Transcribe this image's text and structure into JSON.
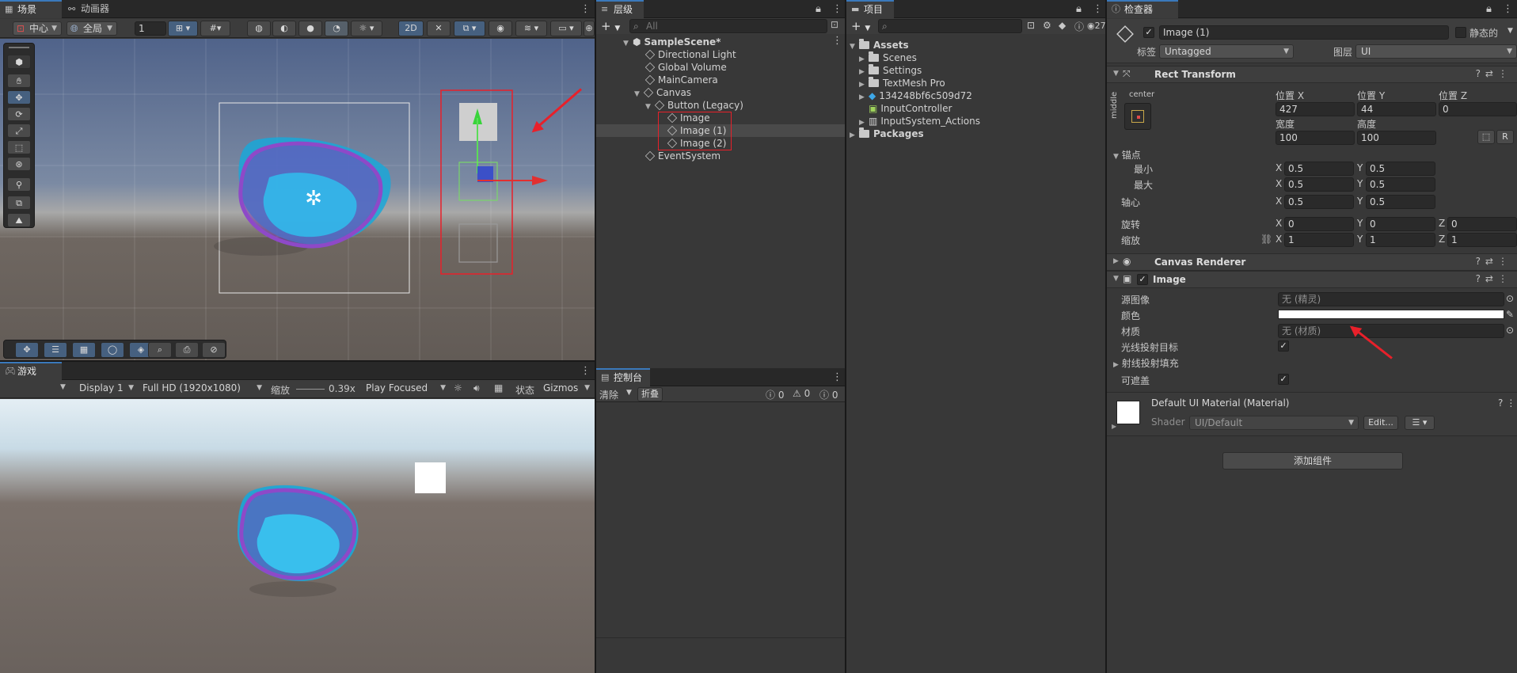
{
  "scene_tabs": {
    "scene": "场景",
    "animator": "动画器"
  },
  "scene_toolbar": {
    "pivot": "中心",
    "space": "全局",
    "grid_value": "1",
    "mode_2d": "2D"
  },
  "game_tab": "游戏",
  "game_toolbar": {
    "display": "Display 1",
    "resolution": "Full HD (1920x1080)",
    "scale_label": "缩放",
    "scale_value": "0.39x",
    "play_mode": "Play Focused",
    "stats": "状态",
    "gizmos": "Gizmos"
  },
  "hierarchy": {
    "tab": "层级",
    "search_placeholder": "All",
    "items": [
      {
        "label": "SampleScene*"
      },
      {
        "label": "Directional Light"
      },
      {
        "label": "Global Volume"
      },
      {
        "label": "MainCamera"
      },
      {
        "label": "Canvas"
      },
      {
        "label": "Button (Legacy)"
      },
      {
        "label": "Image"
      },
      {
        "label": "Image (1)"
      },
      {
        "label": "Image (2)"
      },
      {
        "label": "EventSystem"
      }
    ]
  },
  "console": {
    "tab": "控制台",
    "clear": "清除",
    "collapse": "折叠",
    "count_log": "0",
    "count_warn": "0",
    "count_error": "0"
  },
  "project": {
    "tab": "项目",
    "count": "27",
    "items": [
      {
        "label": "Assets"
      },
      {
        "label": "Scenes"
      },
      {
        "label": "Settings"
      },
      {
        "label": "TextMesh Pro"
      },
      {
        "label": "134248bf6c509d72"
      },
      {
        "label": "InputController"
      },
      {
        "label": "InputSystem_Actions"
      },
      {
        "label": "Packages"
      }
    ]
  },
  "inspector": {
    "tab": "检查器",
    "object_name": "Image (1)",
    "static_label": "静态的",
    "tag_label": "标签",
    "tag_value": "Untagged",
    "layer_label": "图层",
    "layer_value": "UI",
    "rect_transform": {
      "title": "Rect Transform",
      "anchor_h": "center",
      "anchor_v": "middle",
      "pos_x_label": "位置 X",
      "pos_y_label": "位置 Y",
      "pos_z_label": "位置 Z",
      "pos_x": "427",
      "pos_y": "44",
      "pos_z": "0",
      "width_label": "宽度",
      "height_label": "高度",
      "width": "100",
      "height": "100",
      "r_button": "R",
      "anchors_label": "锚点",
      "min_label": "最小",
      "max_label": "最大",
      "min_x": "0.5",
      "min_y": "0.5",
      "max_x": "0.5",
      "max_y": "0.5",
      "pivot_label": "轴心",
      "pivot_x": "0.5",
      "pivot_y": "0.5",
      "rotation_label": "旋转",
      "rot_x": "0",
      "rot_y": "0",
      "rot_z": "0",
      "scale_label": "缩放",
      "scale_x": "1",
      "scale_y": "1",
      "scale_z": "1",
      "x": "X",
      "y": "Y",
      "z": "Z"
    },
    "canvas_renderer": {
      "title": "Canvas Renderer"
    },
    "image": {
      "title": "Image",
      "source_label": "源图像",
      "source_value": "无 (精灵)",
      "color_label": "颜色",
      "color_value": "#ffffff",
      "material_label": "材质",
      "material_value": "无 (材质)",
      "raycast_label": "光线投射目标",
      "raycast_padding_label": "射线投射填充",
      "maskable_label": "可遮盖"
    },
    "material": {
      "title": "Default UI Material (Material)",
      "shader_label": "Shader",
      "shader_value": "UI/Default",
      "edit": "Edit..."
    },
    "add_component": "添加组件"
  },
  "colors": {
    "accent": "#3a79bb",
    "annotation": "#e8202a",
    "panel_bg": "#383838",
    "tab_bg": "#282828"
  }
}
